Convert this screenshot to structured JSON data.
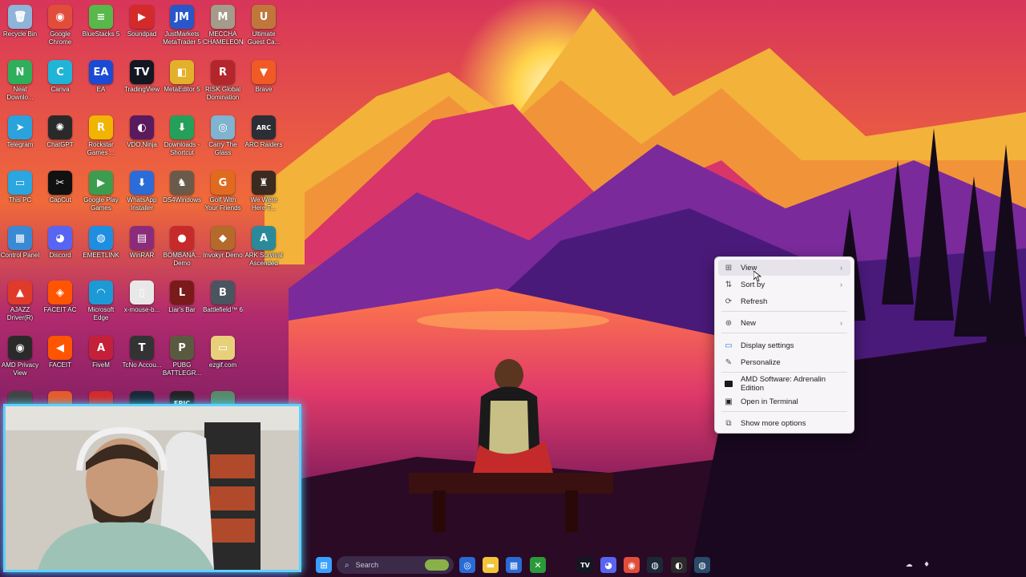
{
  "desktop": {
    "icons": [
      {
        "label": "Recycle Bin",
        "glyph": "🗑",
        "color": "#8fb4d8"
      },
      {
        "label": "Google Chrome",
        "glyph": "◉",
        "color": "#e24d3b"
      },
      {
        "label": "BlueStacks 5",
        "glyph": "≡",
        "color": "#58b84a"
      },
      {
        "label": "Soundpad",
        "glyph": "▶",
        "color": "#d42a2a"
      },
      {
        "label": "JustMarkets MetaTrader 5",
        "glyph": "JM",
        "color": "#2957c9"
      },
      {
        "label": "MECCHA CHAMELEON",
        "glyph": "M",
        "color": "#a59b8a"
      },
      {
        "label": "Ultimate Guest Ca...",
        "glyph": "U",
        "color": "#c0773b"
      },
      {
        "label": "Neat Downlo...",
        "glyph": "N",
        "color": "#2fae5c"
      },
      {
        "label": "Canva",
        "glyph": "C",
        "color": "#20b4d8"
      },
      {
        "label": "EA",
        "glyph": "EA",
        "color": "#1a4bd4"
      },
      {
        "label": "TradingView",
        "glyph": "TV",
        "color": "#131722"
      },
      {
        "label": "MetaEditor 5",
        "glyph": "◧",
        "color": "#e3b02a"
      },
      {
        "label": "RISK Global Domination",
        "glyph": "R",
        "color": "#b3262b"
      },
      {
        "label": "Brave",
        "glyph": "▼",
        "color": "#f05a24"
      },
      {
        "label": "Telegram",
        "glyph": "➤",
        "color": "#2aa3dd"
      },
      {
        "label": "ChatGPT",
        "glyph": "✺",
        "color": "#2a2a2a"
      },
      {
        "label": "Rockstar Games ...",
        "glyph": "R",
        "color": "#f1b400"
      },
      {
        "label": "VDO.Ninja",
        "glyph": "◐",
        "color": "#5a1a5e"
      },
      {
        "label": "Downloads - Shortcut",
        "glyph": "⬇",
        "color": "#24a05b"
      },
      {
        "label": "Carry The Glass",
        "glyph": "◎",
        "color": "#7fb3d0"
      },
      {
        "label": "ARC Raiders",
        "glyph": "ARC",
        "color": "#2d2d35"
      },
      {
        "label": "This PC",
        "glyph": "▭",
        "color": "#2aa6e0"
      },
      {
        "label": "CapCut",
        "glyph": "✂",
        "color": "#111111"
      },
      {
        "label": "Google Play Games",
        "glyph": "▶",
        "color": "#3c9d4f"
      },
      {
        "label": "WhatsApp Installer",
        "glyph": "⬇",
        "color": "#2b6cd8"
      },
      {
        "label": "DS4Windows",
        "glyph": "♞",
        "color": "#6a5a4a"
      },
      {
        "label": "Golf With Your Friends",
        "glyph": "G",
        "color": "#e06b1f"
      },
      {
        "label": "We Were Here T...",
        "glyph": "♜",
        "color": "#3a2a20"
      },
      {
        "label": "Control Panel",
        "glyph": "▦",
        "color": "#3a89d4"
      },
      {
        "label": "Discord",
        "glyph": "◕",
        "color": "#5865f2"
      },
      {
        "label": "EMEETLINK",
        "glyph": "◍",
        "color": "#1e8fe0"
      },
      {
        "label": "WinRAR",
        "glyph": "▤",
        "color": "#8b2c7a"
      },
      {
        "label": "BOMBANA... Demo",
        "glyph": "●",
        "color": "#c72a2a"
      },
      {
        "label": "Invokyr Demo",
        "glyph": "◆",
        "color": "#b46a2a"
      },
      {
        "label": "ARK Survival Ascended",
        "glyph": "A",
        "color": "#2a8a9a"
      },
      {
        "label": "AJAZZ Driver(R)",
        "glyph": "▲",
        "color": "#e03a2a"
      },
      {
        "label": "FACEIT AC",
        "glyph": "◈",
        "color": "#ff5500"
      },
      {
        "label": "Microsoft Edge",
        "glyph": "◠",
        "color": "#1c9ad6"
      },
      {
        "label": "x-mouse-b...",
        "glyph": "▯",
        "color": "#e8e8e8"
      },
      {
        "label": "Liar's Bar",
        "glyph": "L",
        "color": "#7a1a1a"
      },
      {
        "label": "Battlefield™ 6",
        "glyph": "B",
        "color": "#4a5560"
      },
      {
        "label": "AMD Privacy View",
        "glyph": "◉",
        "color": "#2a2a2a"
      },
      {
        "label": "FACEIT",
        "glyph": "◀",
        "color": "#ff5500"
      },
      {
        "label": "FiveM",
        "glyph": "A",
        "color": "#c4203a"
      },
      {
        "label": "TcNo Accou...",
        "glyph": "T",
        "color": "#333333"
      },
      {
        "label": "PUBG BATTLEGR...",
        "glyph": "P",
        "color": "#5a5a40"
      },
      {
        "label": "ezgif.com",
        "glyph": "▭",
        "color": "#e8d07a"
      },
      {
        "label": "",
        "glyph": "",
        "color": "#444444"
      },
      {
        "label": "",
        "glyph": "",
        "color": "#e85a2a"
      },
      {
        "label": "",
        "glyph": "",
        "color": "#d42a2a"
      },
      {
        "label": "",
        "glyph": "",
        "color": "#1b2838"
      },
      {
        "label": "",
        "glyph": "EPIC",
        "color": "#222222"
      },
      {
        "label": "",
        "glyph": "",
        "color": "#5a8a6a"
      }
    ]
  },
  "context_menu": {
    "items": [
      {
        "label": "View",
        "icon": "grid-icon",
        "glyph": "⊞",
        "has_submenu": true
      },
      {
        "label": "Sort by",
        "icon": "sort-icon",
        "glyph": "⇅",
        "has_submenu": true
      },
      {
        "label": "Refresh",
        "icon": "refresh-icon",
        "glyph": "⟳",
        "has_submenu": false
      },
      {
        "label": "New",
        "icon": "plus-icon",
        "glyph": "⊕",
        "has_submenu": true
      },
      {
        "label": "Display settings",
        "icon": "display-icon",
        "glyph": "▭",
        "has_submenu": false
      },
      {
        "label": "Personalize",
        "icon": "brush-icon",
        "glyph": "✎",
        "has_submenu": false
      },
      {
        "label": "AMD Software: Adrenalin Edition",
        "icon": "amd-icon",
        "glyph": "",
        "has_submenu": false
      },
      {
        "label": "Open in Terminal",
        "icon": "terminal-icon",
        "glyph": "▣",
        "has_submenu": false
      },
      {
        "label": "Show more options",
        "icon": "more-options-icon",
        "glyph": "⧉",
        "has_submenu": false
      }
    ],
    "arrow": "›"
  },
  "taskbar": {
    "search_placeholder": "Search",
    "apps": [
      {
        "name": "taskbar-windows-icon",
        "glyph": "⊞",
        "color": "#3aa0ff"
      },
      {
        "name": "taskbar-copilot-icon",
        "glyph": "◎",
        "color": "#2a6ad4"
      },
      {
        "name": "taskbar-explorer-icon",
        "glyph": "▬",
        "color": "#f2c43a"
      },
      {
        "name": "taskbar-store-icon",
        "glyph": "▦",
        "color": "#2a6ad4"
      },
      {
        "name": "taskbar-xbox-icon",
        "glyph": "✕",
        "color": "#2a9a3a"
      },
      {
        "name": "taskbar-tradingview-icon",
        "glyph": "TV",
        "color": "#131722"
      },
      {
        "name": "taskbar-discord-icon",
        "glyph": "◕",
        "color": "#5865f2"
      },
      {
        "name": "taskbar-chrome-icon",
        "glyph": "◉",
        "color": "#e24d3b"
      },
      {
        "name": "taskbar-steam-icon",
        "glyph": "◍",
        "color": "#1b2838"
      },
      {
        "name": "taskbar-obs-icon",
        "glyph": "◐",
        "color": "#2a2a2a"
      },
      {
        "name": "taskbar-steam2-icon",
        "glyph": "◍",
        "color": "#2a4a6a"
      }
    ]
  }
}
